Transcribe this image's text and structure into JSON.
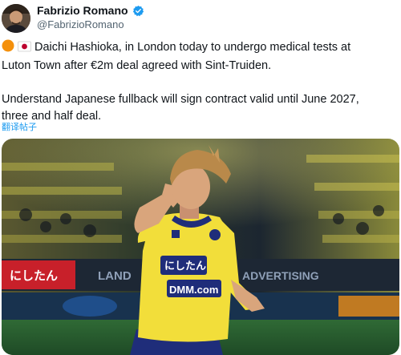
{
  "tweet": {
    "author": {
      "display_name": "Fabrizio Romano",
      "handle": "@FabrizioRomano",
      "verified": true,
      "avatar_icon": "profile-photo"
    },
    "lines": [
      "Daichi Hashioka, in London today to undergo medical tests at",
      "Luton Town after €2m deal agreed with Sint-Truiden.",
      "Understand Japanese fullback will sign contract valid until June 2027,",
      "three and half deal."
    ],
    "emojis": [
      "orange-circle-emoji",
      "japan-flag-emoji"
    ],
    "translate_label": "翻译帖子",
    "media": {
      "description_icon": "football-player-photo",
      "banners": [
        "DMM.com",
        "LAND",
        "ADVERTISING",
        "にしたん"
      ]
    }
  },
  "colors": {
    "accent": "#1d9bf0",
    "text": "#0f1419",
    "secondary": "#536471",
    "jersey": "#f2de3a",
    "jersey_blue": "#1f2d7a"
  }
}
